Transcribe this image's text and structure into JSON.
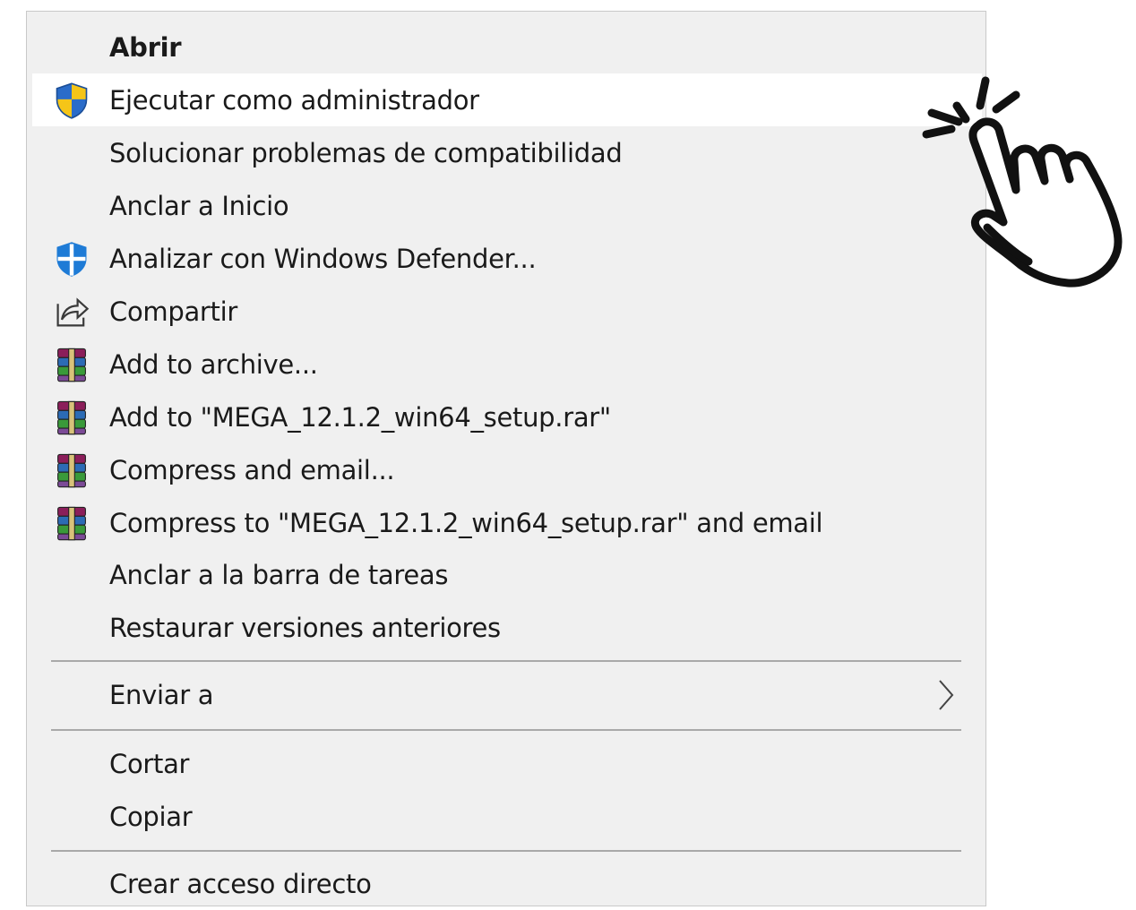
{
  "menu": {
    "items": [
      {
        "label": "Abrir"
      },
      {
        "label": "Ejecutar como administrador",
        "icon": "uac-shield-icon"
      },
      {
        "label": "Solucionar problemas de compatibilidad"
      },
      {
        "label": "Anclar a Inicio"
      },
      {
        "label": "Analizar con Windows Defender...",
        "icon": "windows-defender-icon"
      },
      {
        "label": "Compartir",
        "icon": "share-icon"
      },
      {
        "label": "Add to archive...",
        "icon": "winrar-icon"
      },
      {
        "label": "Add to \"MEGA_12.1.2_win64_setup.rar\"",
        "icon": "winrar-icon"
      },
      {
        "label": "Compress and email...",
        "icon": "winrar-icon"
      },
      {
        "label": "Compress to \"MEGA_12.1.2_win64_setup.rar\" and email",
        "icon": "winrar-icon"
      },
      {
        "label": "Anclar a la barra de tareas"
      },
      {
        "label": "Restaurar versiones anteriores"
      },
      {
        "label": "Enviar a",
        "icon": "chevron-right-icon"
      },
      {
        "label": "Cortar"
      },
      {
        "label": "Copiar"
      },
      {
        "label": "Crear acceso directo"
      }
    ]
  },
  "colors": {
    "menu_background": "#f0f0f0",
    "hover_background": "#ffffff",
    "separator": "#a9a9a9",
    "text": "#1a1a1a"
  },
  "overlay": {
    "icon": "pointing-hand-cursor-icon"
  }
}
